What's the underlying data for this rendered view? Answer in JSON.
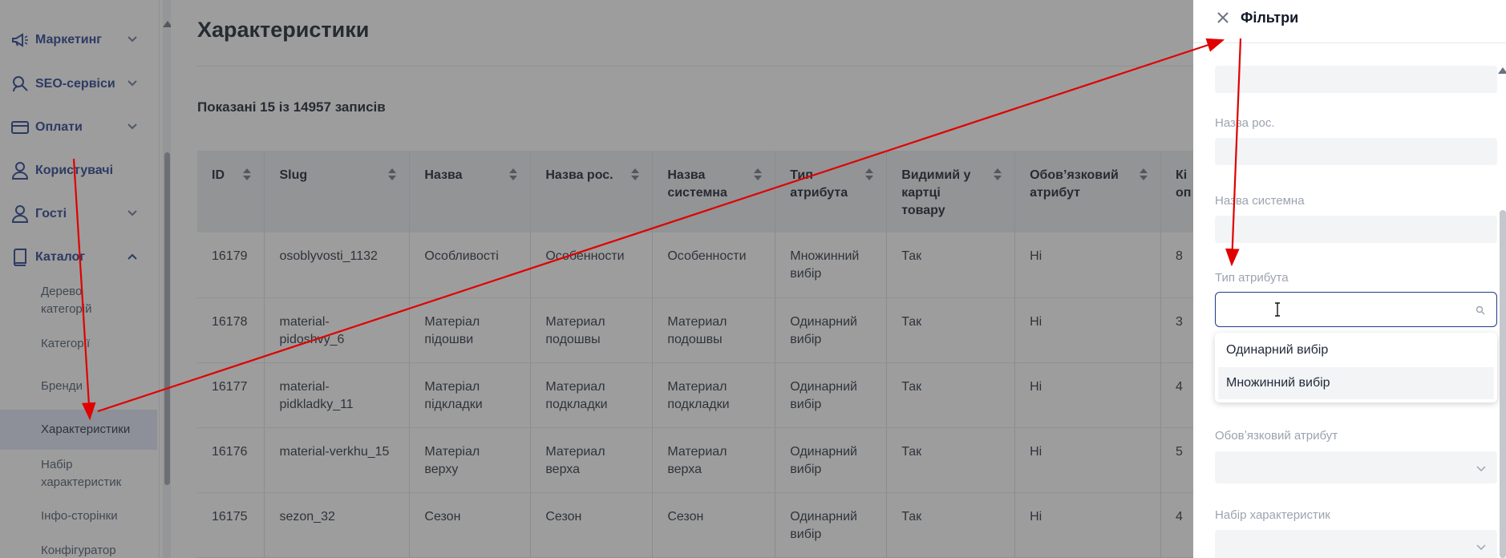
{
  "sidebar": {
    "items": [
      {
        "label": "Маркетинг",
        "icon": "megaphone-icon"
      },
      {
        "label": "SEO-сервіси",
        "icon": "seo-search-icon"
      },
      {
        "label": "Оплати",
        "icon": "credit-card-icon"
      },
      {
        "label": "Користувачі",
        "icon": "user-icon"
      },
      {
        "label": "Гості",
        "icon": "guest-icon"
      },
      {
        "label": "Каталог",
        "icon": "book-icon"
      }
    ],
    "catalog_sub": [
      "Дерево категорій",
      "Категорії",
      "Бренди",
      "Характеристики",
      "Набір характеристик",
      "Інфо-сторінки",
      "Конфігуратор"
    ]
  },
  "main": {
    "title": "Характеристики",
    "records": "Показані 15 із 14957 записів",
    "table": {
      "headers": [
        "ID",
        "Slug",
        "Назва",
        "Назва рос.",
        "Назва системна",
        "Тип атрибута",
        "Видимий у картці товару",
        "Обовʼязковий атрибут",
        "Кількість опцій"
      ],
      "header_lines": [
        [
          "ID"
        ],
        [
          "Slug"
        ],
        [
          "Назва"
        ],
        [
          "Назва рос."
        ],
        [
          "Назва",
          "системна"
        ],
        [
          "Тип",
          "атрибута"
        ],
        [
          "Видимий у",
          "картці",
          "товару"
        ],
        [
          "Обовʼязковий",
          "атрибут"
        ],
        [
          "Кі",
          "оп"
        ]
      ],
      "rows": [
        {
          "id": "16179",
          "slug": [
            "osoblyvosti_1132"
          ],
          "name": [
            "Особливості"
          ],
          "name_ru": [
            "Особенности"
          ],
          "name_sys": [
            "Особенности"
          ],
          "type": [
            "Множинний",
            "вибір"
          ],
          "visible": "Так",
          "required": "Ні",
          "count": "8"
        },
        {
          "id": "16178",
          "slug": [
            "material-",
            "pidoshvy_6"
          ],
          "name": [
            "Матеріал",
            "підошви"
          ],
          "name_ru": [
            "Материал",
            "подошвы"
          ],
          "name_sys": [
            "Материал",
            "подошвы"
          ],
          "type": [
            "Одинарний",
            "вибір"
          ],
          "visible": "Так",
          "required": "Ні",
          "count": "3"
        },
        {
          "id": "16177",
          "slug": [
            "material-",
            "pidkladky_11"
          ],
          "name": [
            "Матеріал",
            "підкладки"
          ],
          "name_ru": [
            "Материал",
            "подкладки"
          ],
          "name_sys": [
            "Материал",
            "подкладки"
          ],
          "type": [
            "Одинарний",
            "вибір"
          ],
          "visible": "Так",
          "required": "Ні",
          "count": "4"
        },
        {
          "id": "16176",
          "slug": [
            "material-verkhu_15"
          ],
          "name": [
            "Матеріал",
            "верху"
          ],
          "name_ru": [
            "Материал",
            "верха"
          ],
          "name_sys": [
            "Материал",
            "верха"
          ],
          "type": [
            "Одинарний",
            "вибір"
          ],
          "visible": "Так",
          "required": "Ні",
          "count": "5"
        },
        {
          "id": "16175",
          "slug": [
            "sezon_32"
          ],
          "name": [
            "Сезон"
          ],
          "name_ru": [
            "Сезон"
          ],
          "name_sys": [
            "Сезон"
          ],
          "type": [
            "Одинарний",
            "вибір"
          ],
          "visible": "Так",
          "required": "Ні",
          "count": "4"
        }
      ]
    }
  },
  "filters": {
    "title": "Фільтри",
    "label_name_ru": "Назва рос.",
    "label_name_sys": "Назва системна",
    "label_type": "Тип атрибута",
    "type_value": "",
    "type_options": [
      "Одинарний вибір",
      "Множинний вибір"
    ],
    "label_required": "Обовʼязковий атрибут",
    "label_set": "Набір характеристик"
  },
  "colors": {
    "arrow": "#e00000",
    "nav_text": "#1e3a8a",
    "active_sub_bg": "#dfe4f5"
  }
}
